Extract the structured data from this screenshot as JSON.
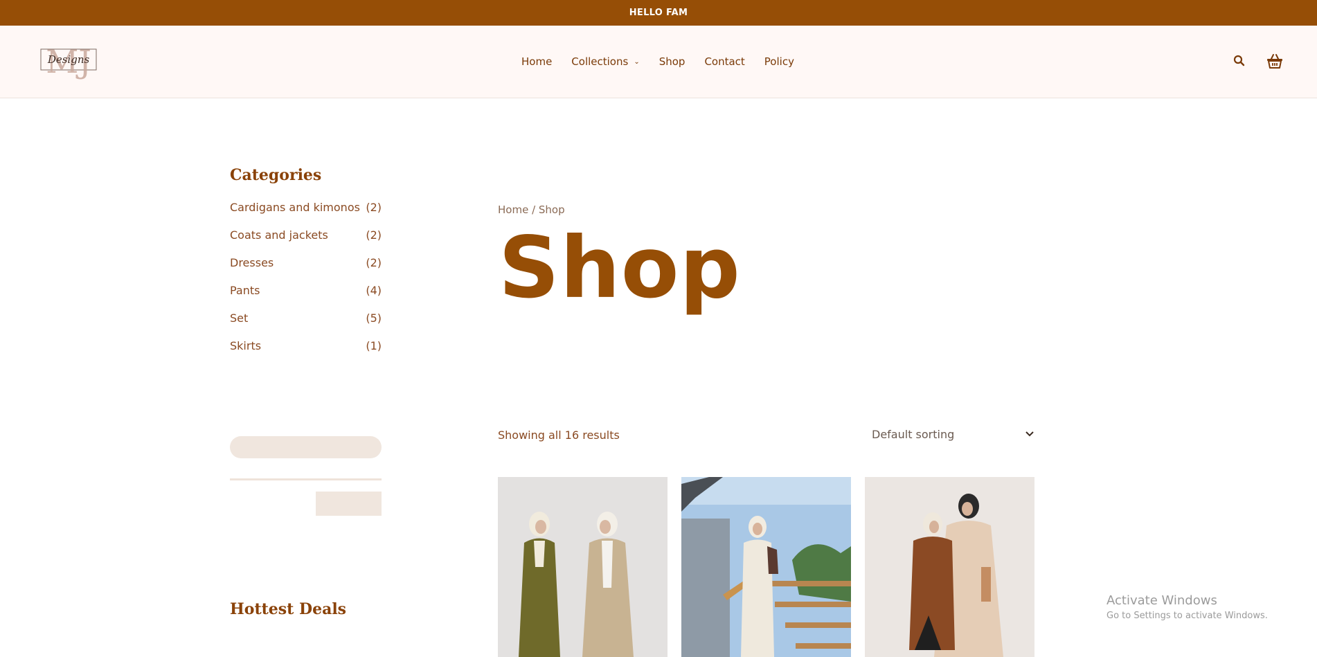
{
  "announcement": "HELLO FAM",
  "logo": {
    "text": "Designs",
    "monogram": "MJ"
  },
  "nav": {
    "items": [
      {
        "label": "Home"
      },
      {
        "label": "Collections",
        "has_dropdown": true
      },
      {
        "label": "Shop"
      },
      {
        "label": "Contact"
      },
      {
        "label": "Policy"
      }
    ]
  },
  "header_icons": [
    "search-icon",
    "cart-icon"
  ],
  "sidebar": {
    "categories_title": "Categories",
    "categories": [
      {
        "label": "Cardigans and kimonos",
        "count": "(2)"
      },
      {
        "label": "Coats and jackets",
        "count": "(2)"
      },
      {
        "label": "Dresses",
        "count": "(2)"
      },
      {
        "label": "Pants",
        "count": "(4)"
      },
      {
        "label": "Set",
        "count": "(5)"
      },
      {
        "label": "Skirts",
        "count": "(1)"
      }
    ],
    "hottest_deals_title": "Hottest Deals"
  },
  "main": {
    "breadcrumb": {
      "home": "Home",
      "separator": " / ",
      "current": "Shop"
    },
    "title": "Shop",
    "results_text": "Showing all 16 results",
    "sort_selected": "Default sorting"
  },
  "products": [
    {
      "image": "product-image-two-models-coats"
    },
    {
      "image": "product-image-model-on-stairs"
    },
    {
      "image": "product-image-two-models-ponchos"
    }
  ],
  "watermark": {
    "line1": "Activate Windows",
    "line2": "Go to Settings to activate Windows."
  },
  "colors": {
    "brand": "#964e06",
    "header_bg": "#fff8f6",
    "placeholder": "#f0e6de"
  }
}
